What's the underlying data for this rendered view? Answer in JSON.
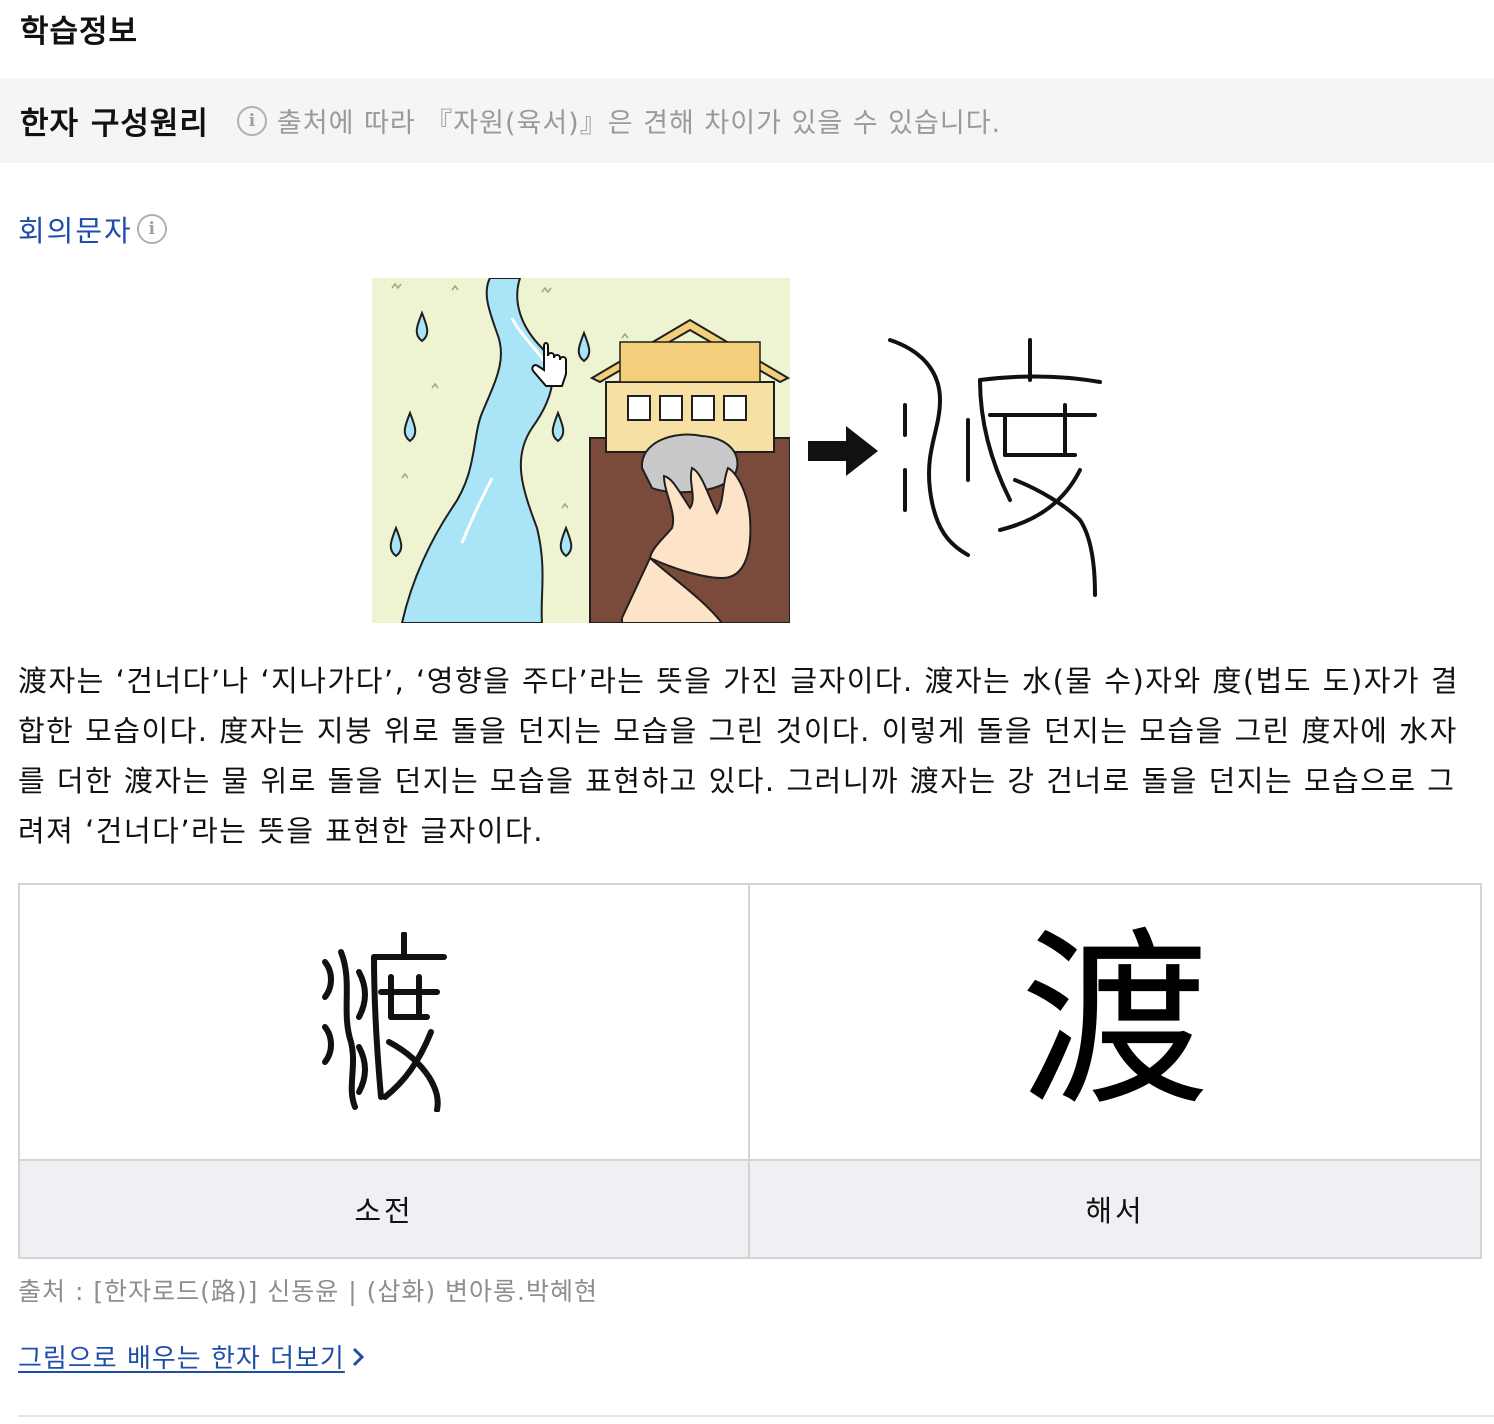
{
  "header": {
    "title": "학습정보"
  },
  "banner": {
    "title": "한자 구성원리",
    "info_icon": "info-icon",
    "note": "출처에 따라 『자원(육서)』은 견해 차이가 있을 수 있습니다."
  },
  "formation": {
    "type_label": "회의문자",
    "info_icon": "info-icon"
  },
  "description": "渡자는 ‘건너다’나 ‘지나가다’, ‘영향을 주다’라는 뜻을 가진 글자이다. 渡자는 水(물 수)자와 度(법도 도)자가 결합한 모습이다. 度자는 지붕 위로 돌을 던지는 모습을 그린 것이다. 이렇게 돌을 던지는 모습을 그린 度자에 水자를 더한 渡자는 물 위로 돌을 던지는 모습을 표현하고 있다. 그러니까 渡자는 강 건너로 돌을 던지는 모습으로 그려져 ‘건너다’라는 뜻을 표현한 글자이다.",
  "scripts": {
    "seal_label": "소전",
    "regular_label": "해서",
    "regular_char": "渡"
  },
  "source": "출처 : [한자로드(路)] 신동윤 | (삽화) 변아롱.박혜현",
  "more_link": {
    "label": "그림으로 배우는 한자 더보기",
    "icon": "chevron-right-icon"
  },
  "colors": {
    "link": "#1f4ea8",
    "banner_bg": "#f5f5f5",
    "label_bg": "#eef0f3"
  }
}
